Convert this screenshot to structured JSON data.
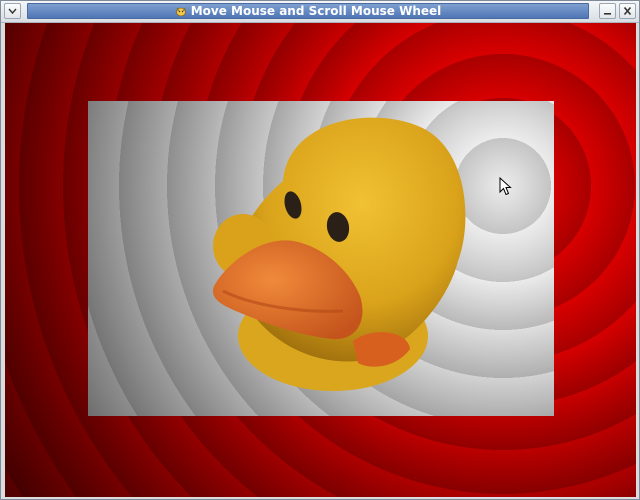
{
  "window": {
    "title": "Move Mouse and Scroll Mouse Wheel",
    "app_icon": "gnu-icon"
  },
  "titlebar_buttons": {
    "menu": "chevron-down-icon",
    "minimize": "minimize-icon",
    "close": "close-icon"
  },
  "canvas": {
    "background_colors": [
      "#d80000",
      "#a80000"
    ],
    "photo_subject": "duck-plush-photo",
    "cursor": "arrow-cursor-icon"
  }
}
